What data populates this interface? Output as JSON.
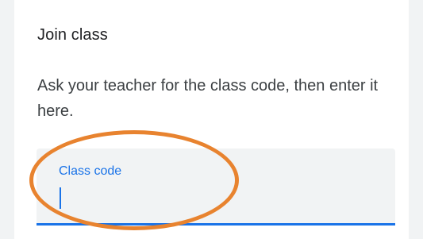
{
  "dialog": {
    "title": "Join class",
    "description": "Ask your teacher for the class code, then enter it here.",
    "class_code_field": {
      "label": "Class code",
      "value": ""
    }
  },
  "colors": {
    "accent": "#1a73e8",
    "highlight": "#e8832f"
  }
}
